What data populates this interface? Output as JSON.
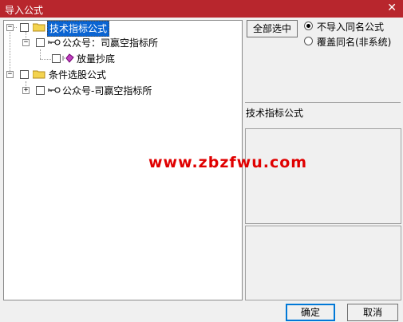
{
  "window": {
    "title": "导入公式",
    "close_glyph": "✕"
  },
  "tree": {
    "root1": {
      "label": "技术指标公式",
      "child": {
        "label": "公众号：司赢空指标所",
        "leaf": {
          "label": "放量抄底"
        }
      }
    },
    "root2": {
      "label": "条件选股公式",
      "child": {
        "label": "公众号-司赢空指标所"
      }
    }
  },
  "controls": {
    "select_all_label": "全部选中",
    "radio_no_import": "不导入同名公式",
    "radio_overwrite": "覆盖同名(非系统)",
    "category_label": "技术指标公式",
    "ok_label": "确定",
    "cancel_label": "取消"
  },
  "watermark": {
    "text": "www.zbzfwu.com"
  },
  "colors": {
    "titlebar": "#b8262d",
    "selection": "#0a64d2",
    "watermark": "#e00000"
  }
}
